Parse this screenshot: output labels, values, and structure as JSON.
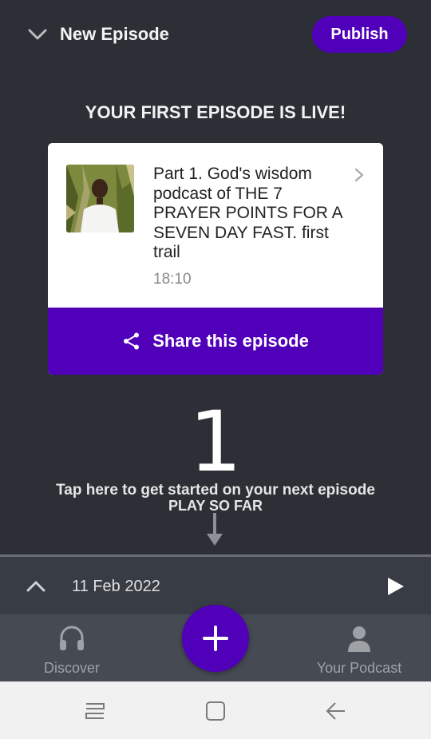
{
  "header": {
    "title": "New Episode",
    "publish_label": "Publish",
    "back_icon": "chevron-down-icon"
  },
  "live": {
    "heading": "YOUR FIRST EPISODE IS LIVE!"
  },
  "episode": {
    "title": "Part 1. God's wisdom podcast of THE 7 PRAYER POINTS FOR A SEVEN DAY FAST. first trail",
    "duration": "18:10",
    "share_label": "Share this episode"
  },
  "prompt": {
    "number": "1",
    "tap_text": "Tap here to get started on your next episode",
    "play_so_far": "PLAY SO FAR"
  },
  "player": {
    "date": "11 Feb 2022"
  },
  "tabs": [
    {
      "label": "Discover",
      "icon": "headphones-icon"
    },
    {
      "label": "Your Podcast",
      "icon": "user-icon"
    }
  ],
  "colors": {
    "background": "#2c2f35",
    "accent": "#5000b9",
    "tabbar": "#464a52",
    "player": "#383c44"
  }
}
